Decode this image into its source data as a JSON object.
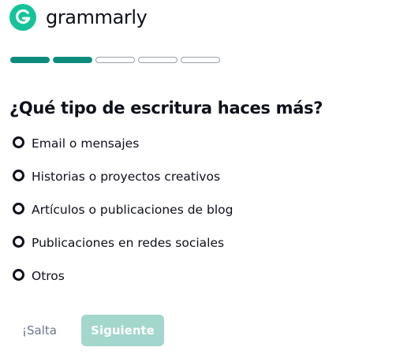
{
  "brand": {
    "name": "grammarly",
    "logo_icon": "grammarly-g-logo",
    "logo_color": "#15c39a"
  },
  "progress": {
    "total_steps": 5,
    "completed_steps": 2,
    "filled_color": "#0d8c7e"
  },
  "question": "¿Qué tipo de escritura haces más?",
  "options": [
    {
      "label": "Email o mensajes"
    },
    {
      "label": "Historias o proyectos creativos"
    },
    {
      "label": "Artículos o publicaciones de blog"
    },
    {
      "label": "Publicaciones en redes sociales"
    },
    {
      "label": "Otros"
    }
  ],
  "actions": {
    "skip_label": "¡Salta",
    "next_label": "Siguiente",
    "next_color": "#a3d6cc"
  }
}
